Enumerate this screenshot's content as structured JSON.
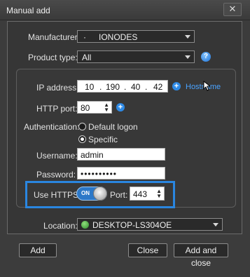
{
  "window": {
    "title": "Manual add",
    "close_glyph": "✕"
  },
  "fields": {
    "manufacturer_label": "Manufacturer:",
    "manufacturer_value": "IONODES",
    "product_type_label": "Product type:",
    "product_type_value": "All",
    "ip_label": "IP address:",
    "ip_octets": [
      "10",
      "190",
      "40",
      "42"
    ],
    "hostname_link": "Hostname",
    "http_port_label": "HTTP port:",
    "http_port_value": "80",
    "auth_label": "Authentication:",
    "auth_options": [
      "Default logon",
      "Specific"
    ],
    "auth_selected": "Specific",
    "username_label": "Username:",
    "username_value": "admin",
    "password_label": "Password:",
    "password_value": "••••••••••",
    "https_label": "Use HTTPS:",
    "https_toggle": "ON",
    "https_port_label": "Port:",
    "https_port_value": "443",
    "location_label": "Location:",
    "location_value": "DESKTOP-LS304OE"
  },
  "buttons": {
    "add": "Add",
    "close": "Close",
    "add_and_close": "Add and close"
  },
  "icons": {
    "info": "?",
    "plus": "+",
    "spin_up": "▲",
    "spin_down": "▼"
  },
  "colors": {
    "accent": "#2a86e0",
    "link": "#4aa3ff",
    "toggle_on": "#2c78c8"
  }
}
